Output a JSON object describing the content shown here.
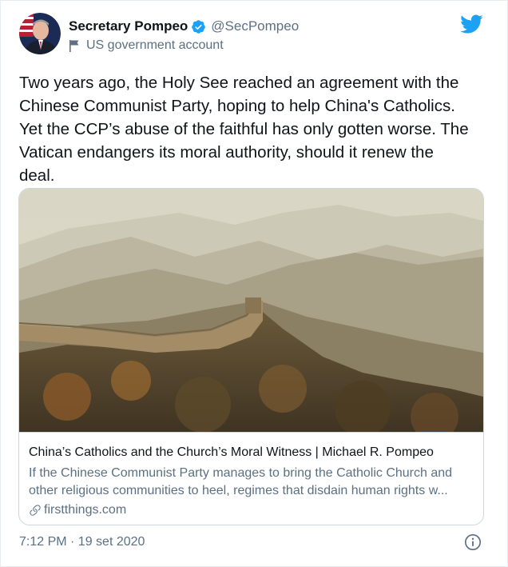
{
  "author": {
    "display_name": "Secretary Pompeo",
    "handle": "@SecPompeo",
    "account_label": "US government account",
    "verified_icon": "verified-badge-icon",
    "label_icon": "flag-icon"
  },
  "tweet": {
    "text": "Two years ago, the Holy See reached an agreement with the\nChinese Communist Party, hoping to help China's Catholics.\nYet the CCP’s abuse of the faithful has only gotten worse. The\nVatican endangers its moral authority, should it renew the\ndeal.",
    "timestamp": "7:12 PM · 19 set 2020"
  },
  "card": {
    "image_alt": "Great Wall of China on misty mountains",
    "title": "China’s Catholics and the Church’s Moral Witness | Michael R. Pompeo",
    "description": "If the Chinese Communist Party manages to bring the Catholic Church and\nother religious communities to heel, regimes that disdain human rights w...",
    "domain": "firstthings.com",
    "link_icon": "link-icon"
  },
  "icons": {
    "brand": "twitter-bird-icon",
    "info": "info-icon"
  },
  "colors": {
    "text_primary": "#0f1419",
    "text_secondary": "#5b7083",
    "twitter_blue": "#1da1f2",
    "border": "#ccd6dd"
  }
}
